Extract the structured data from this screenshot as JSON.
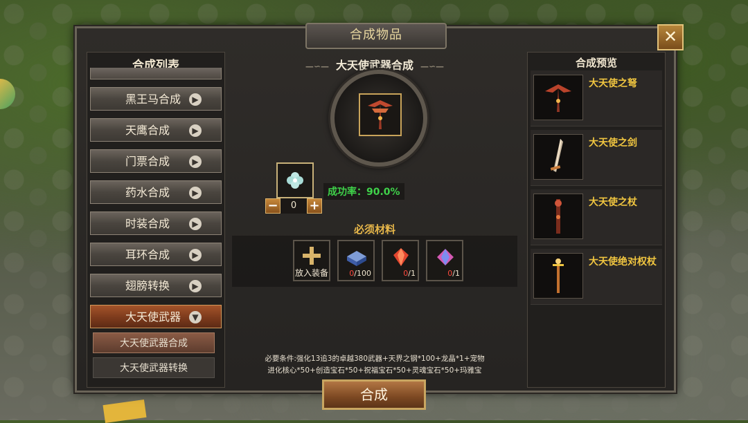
{
  "window": {
    "title": "合成物品",
    "close_label": "✕"
  },
  "left_panel": {
    "title": "合成列表",
    "items": [
      {
        "label": "黑王马合成",
        "active": false
      },
      {
        "label": "天鹰合成",
        "active": false
      },
      {
        "label": "门票合成",
        "active": false
      },
      {
        "label": "药水合成",
        "active": false
      },
      {
        "label": "时装合成",
        "active": false
      },
      {
        "label": "耳环合成",
        "active": false
      },
      {
        "label": "翅膀转换",
        "active": false
      },
      {
        "label": "大天使武器",
        "active": true
      }
    ],
    "sub_items": [
      {
        "label": "大天使武器合成",
        "active": true
      },
      {
        "label": "大天使武器转换",
        "active": false
      }
    ]
  },
  "center": {
    "recipe_title": "大天使武器合成",
    "success_rate": "成功率：90.0%",
    "stepper_value": "0",
    "stepper_minus": "−",
    "stepper_plus": "+",
    "required_title": "必须材料",
    "materials": [
      {
        "kind": "add",
        "label": "放入装备",
        "count": ""
      },
      {
        "kind": "box",
        "count_have": "0",
        "count_need": "/100"
      },
      {
        "kind": "red-gem",
        "count_have": "0",
        "count_need": "/1"
      },
      {
        "kind": "pink-gem",
        "count_have": "0",
        "count_need": "/1"
      }
    ],
    "conditions_line1": "必要条件:强化13追3的卓越380武器+天界之钢*100+龙晶*1+宠物",
    "conditions_line2": "进化核心*50+创造宝石*50+祝福宝石*50+灵魂宝石*50+玛雅宝",
    "craft_button": "合成"
  },
  "right_panel": {
    "title": "合成预览",
    "items": [
      {
        "name": "大天使之弩",
        "icon": "crossbow-icon"
      },
      {
        "name": "大天使之剑",
        "icon": "sword-icon"
      },
      {
        "name": "大天使之杖",
        "icon": "staff-icon"
      },
      {
        "name": "大天使绝对权杖",
        "icon": "scepter-icon"
      }
    ]
  },
  "colors": {
    "accent_gold": "#f1c640",
    "success_green": "#3fd24a",
    "active_red": "#8a3d1c"
  }
}
